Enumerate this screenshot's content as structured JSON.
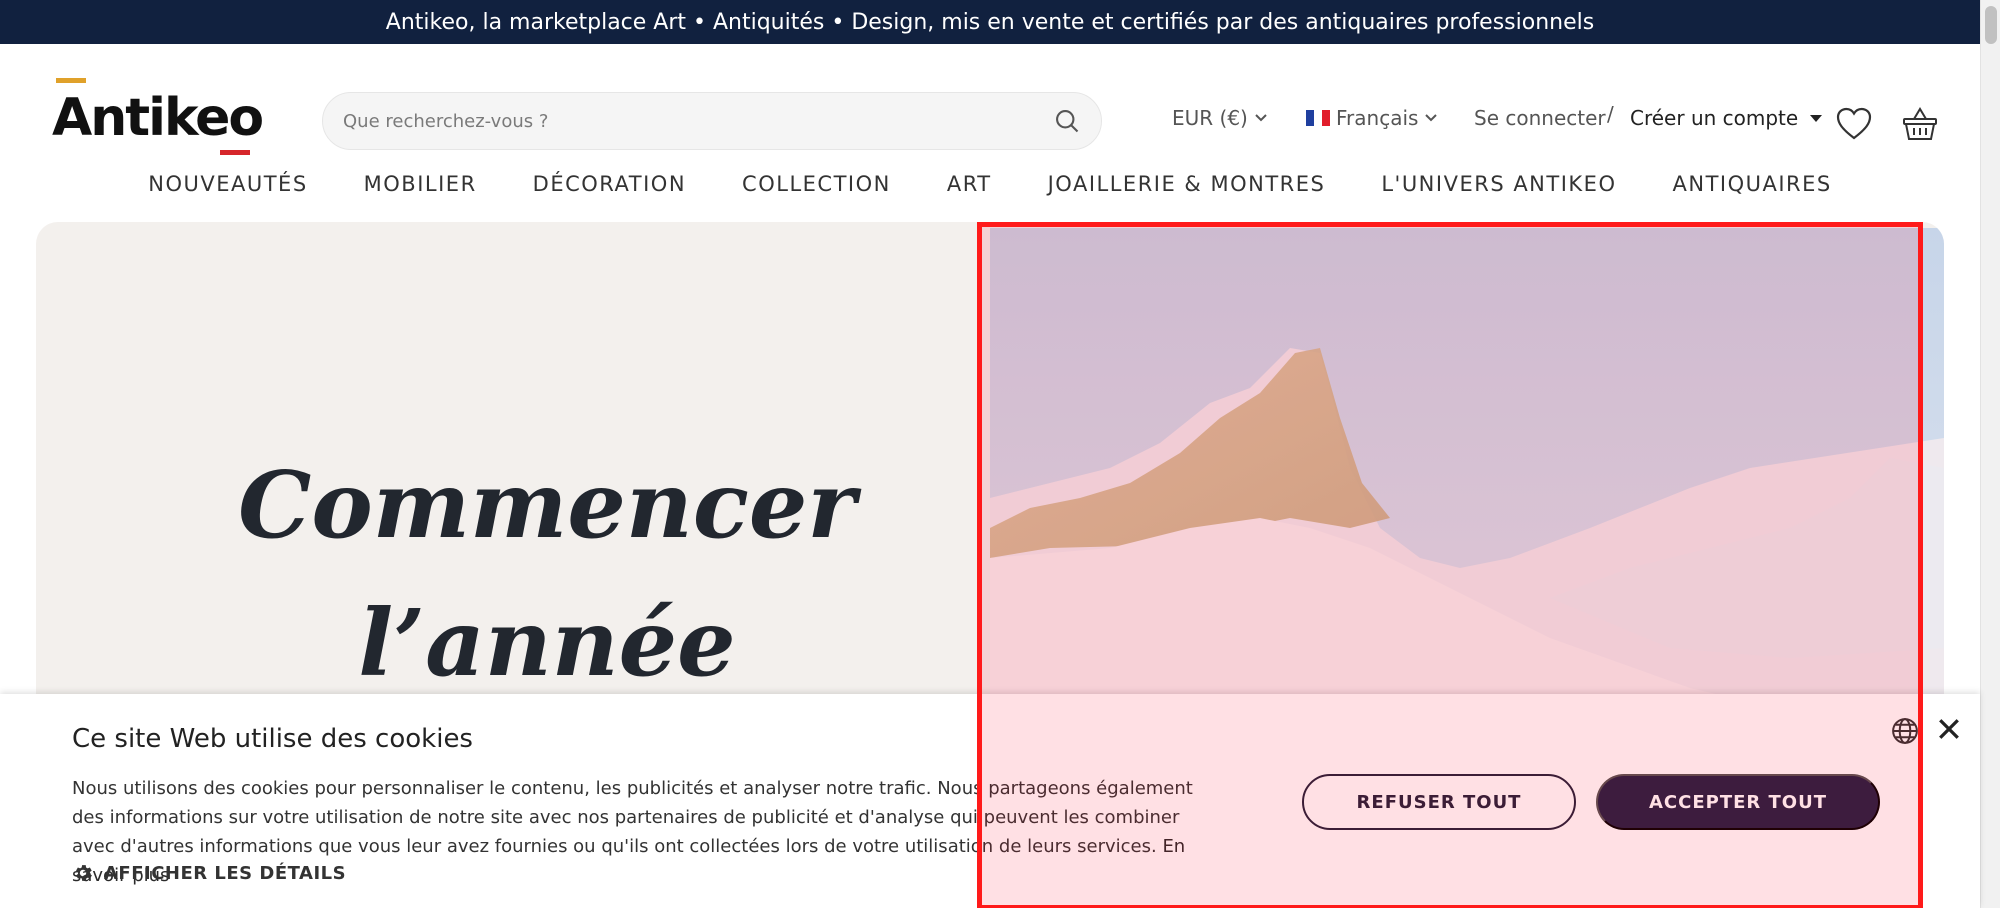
{
  "topbar": {
    "text": "Antikeo, la marketplace Art • Antiquités • Design, mis en vente et certifiés par des antiquaires professionnels"
  },
  "header": {
    "logo_text": "Antikeo",
    "search_placeholder": "Que recherchez-vous ?",
    "currency": "EUR (€)",
    "language": "Français",
    "login": "Se connecter",
    "separator": "/",
    "create_account": "Créer un compte"
  },
  "nav": {
    "items": [
      "NOUVEAUTÉS",
      "MOBILIER",
      "DÉCORATION",
      "COLLECTION",
      "ART",
      "JOAILLERIE & MONTRES",
      "L'UNIVERS ANTIKEO",
      "ANTIQUAIRES"
    ]
  },
  "hero": {
    "title_line1": "Commencer",
    "title_line2": "l’année autrement"
  },
  "cookie": {
    "title": "Ce site Web utilise des cookies",
    "body": "Nous utilisons des cookies pour personnaliser le contenu, les publicités et analyser notre trafic. Nous partageons également des informations sur votre utilisation de notre site avec nos partenaires de publicité et d'analyse qui peuvent les combiner avec d'autres informations que vous leur avez fournies ou qu'ils ont collectées lors de votre utilisation de leurs services.",
    "learn_more": "En savoir plus",
    "details": "AFFICHER LES DÉTAILS",
    "refuse": "REFUSER TOUT",
    "accept": "ACCEPTER TOUT"
  },
  "icons": {
    "search": "search-icon",
    "heart": "heart-icon",
    "basket": "basket-icon",
    "gear": "gear-icon",
    "globe": "globe-icon",
    "close": "close-icon"
  },
  "colors": {
    "topbar_bg": "#11213f",
    "accept_bg": "#232043",
    "highlight": "#ff1a1a",
    "logo_accent_top": "#e0a12a",
    "logo_accent_bottom": "#d6262b"
  }
}
